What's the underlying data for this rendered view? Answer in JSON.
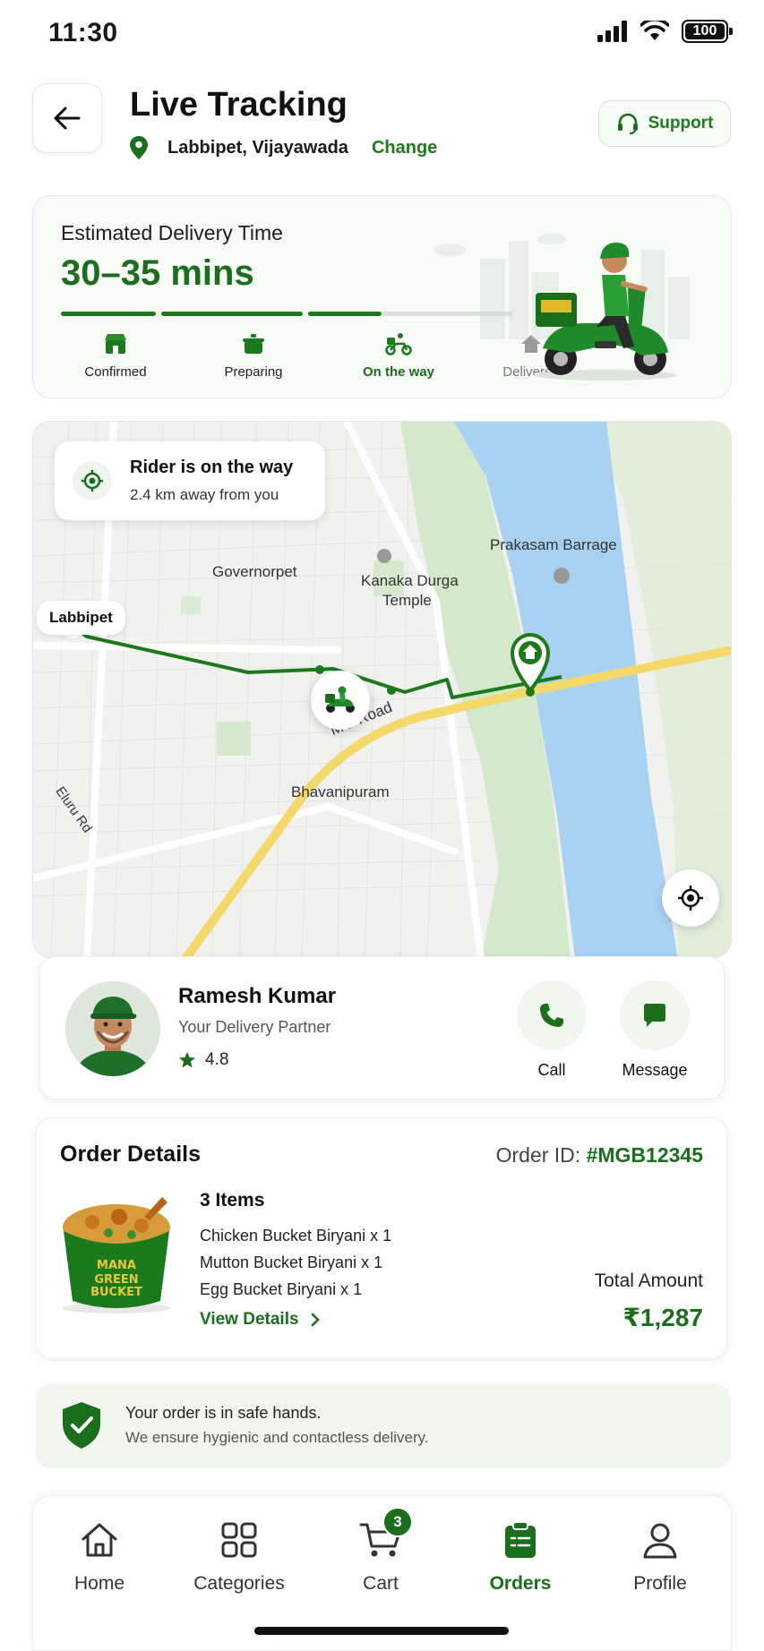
{
  "status_bar": {
    "time": "11:30",
    "battery": "100"
  },
  "header": {
    "title": "Live Tracking",
    "location": "Labbipet, Vijayawada",
    "change_label": "Change",
    "support_label": "Support"
  },
  "eta": {
    "label": "Estimated Delivery Time",
    "time": "30–35 mins",
    "steps": [
      {
        "label": "Confirmed",
        "icon": "store-icon",
        "state": "done"
      },
      {
        "label": "Preparing",
        "icon": "cooking-pot-icon",
        "state": "done"
      },
      {
        "label": "On the way",
        "icon": "scooter-icon",
        "state": "active"
      },
      {
        "label": "Delivered",
        "icon": "home-icon",
        "state": "pending"
      }
    ]
  },
  "map": {
    "rider_banner": {
      "title": "Rider is on the way",
      "subtitle": "2.4 km away from you"
    },
    "pin_label": "Labbipet",
    "labels": {
      "governorpet": "Governorpet",
      "kanaka": "Kanaka Durga",
      "temple": "Temple",
      "prakasam": "Prakasam Barrage",
      "mg_road": "MG Road",
      "bhavanipuram": "Bhavanipuram",
      "eluru": "Eluru Rd"
    }
  },
  "partner": {
    "name": "Ramesh Kumar",
    "role": "Your Delivery Partner",
    "rating": "4.8",
    "call_label": "Call",
    "message_label": "Message"
  },
  "order": {
    "title": "Order Details",
    "id_label": "Order ID:",
    "id": "#MGB12345",
    "count": "3 Items",
    "items": [
      "Chicken Bucket Biryani x 1",
      "Mutton Bucket Biryani x 1",
      "Egg Bucket Biryani x 1"
    ],
    "view_details": "View Details",
    "total_label": "Total Amount",
    "total": "₹1,287",
    "image_brand": "MANA GREEN BUCKET"
  },
  "safe": {
    "title": "Your order is in safe hands.",
    "subtitle": "We ensure hygienic and contactless delivery."
  },
  "tabs": [
    {
      "label": "Home",
      "icon": "home-icon"
    },
    {
      "label": "Categories",
      "icon": "grid-icon"
    },
    {
      "label": "Cart",
      "icon": "cart-icon",
      "badge": "3"
    },
    {
      "label": "Orders",
      "icon": "clipboard-icon",
      "active": true
    },
    {
      "label": "Profile",
      "icon": "user-icon"
    }
  ],
  "colors": {
    "brand": "#1b6e1b",
    "brand_light": "#f1f6ef",
    "water": "#a9d1f2",
    "road": "#f5d86a"
  }
}
